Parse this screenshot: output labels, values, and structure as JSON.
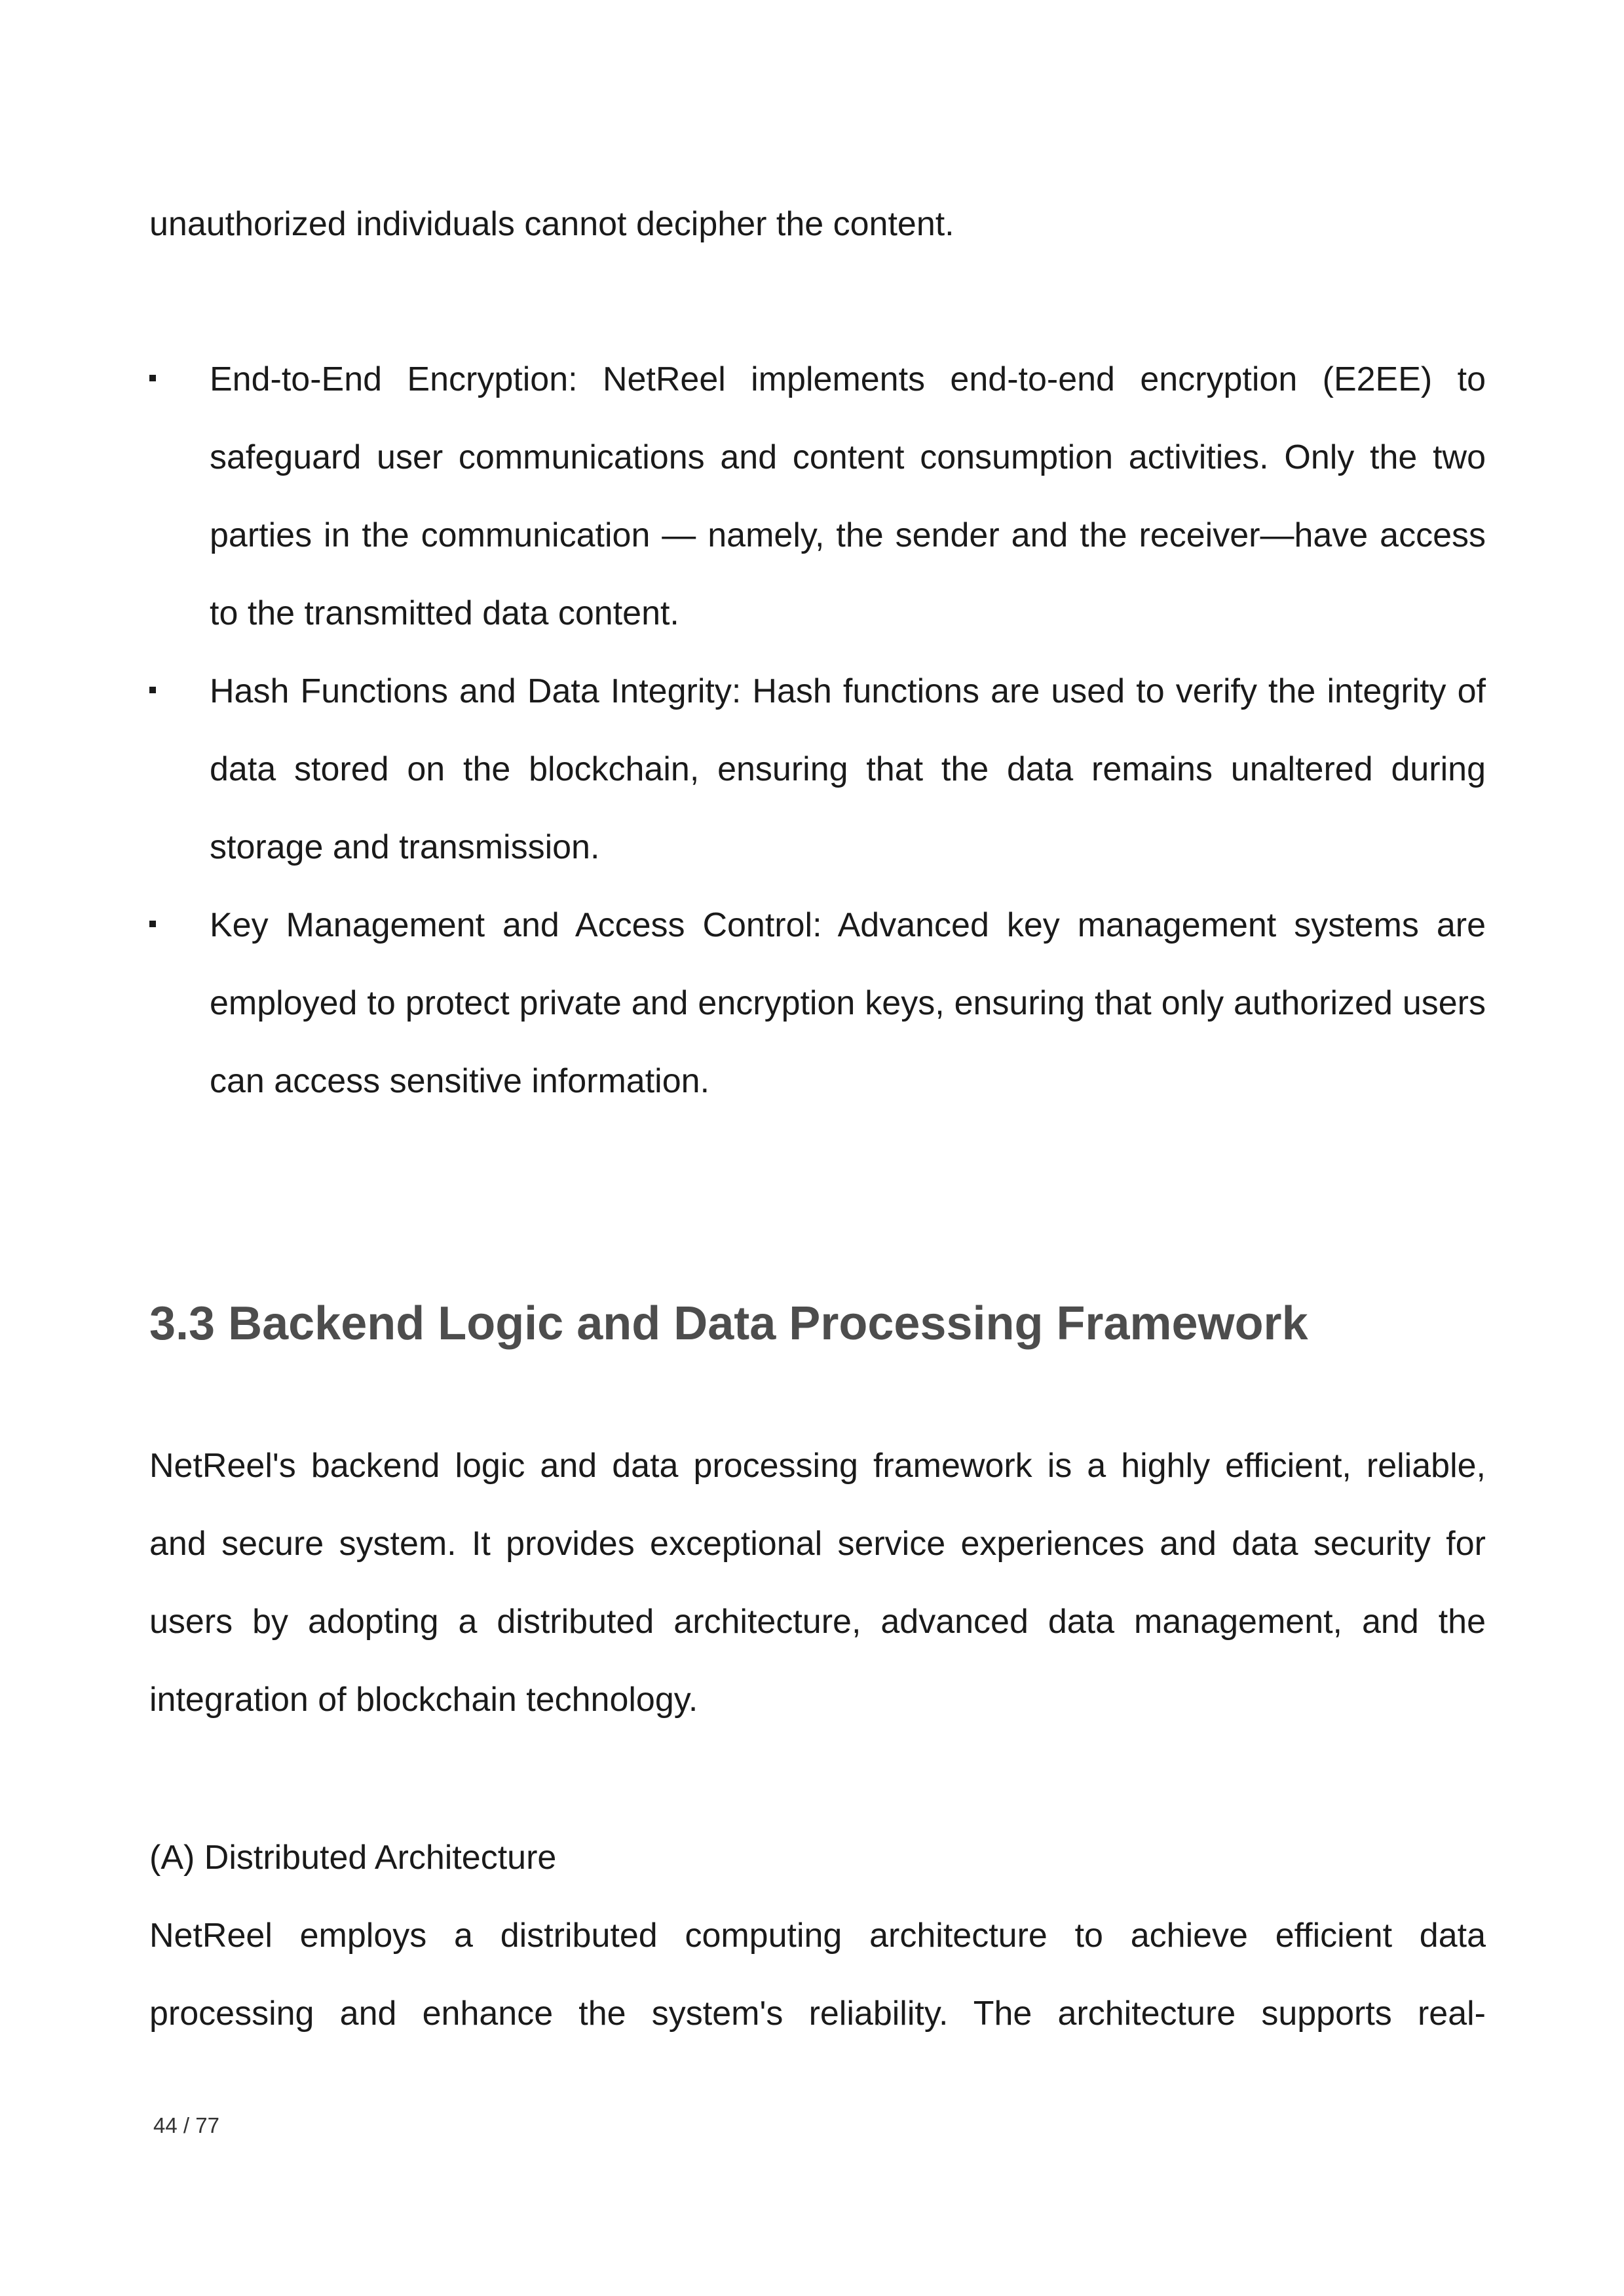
{
  "document": {
    "intro_text": "unauthorized individuals cannot decipher the content.",
    "bullets": [
      {
        "text": "End-to-End Encryption: NetReel implements end-to-end encryption (E2EE) to safeguard user communications and content consumption activities. Only the two parties in the communication — namely, the sender and the receiver—have access to the transmitted data content."
      },
      {
        "text": "Hash Functions and Data Integrity: Hash functions are used to verify the integrity of data stored on the blockchain, ensuring that the data remains unaltered during storage and transmission."
      },
      {
        "text": "Key Management and Access Control: Advanced key management systems are employed to protect private and encryption keys, ensuring that only authorized users can access sensitive information."
      }
    ],
    "section_heading": "3.3 Backend Logic and Data Processing Framework",
    "section_paragraph": "NetReel's backend logic and data processing framework is a highly efficient, reliable, and secure system. It provides exceptional service experiences and data security for users by adopting a distributed architecture, advanced data management, and the integration of blockchain technology.",
    "subheading_a": "(A) Distributed Architecture",
    "paragraph_a": "NetReel employs a distributed computing architecture to achieve efficient data processing and enhance the system's reliability. The architecture supports real-",
    "page_number": "44 / 77"
  }
}
